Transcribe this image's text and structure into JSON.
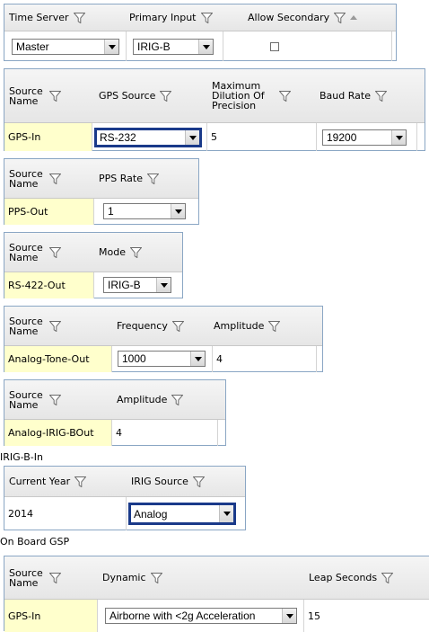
{
  "time_server_table": {
    "headers": [
      "Time Server",
      "Primary Input",
      "Allow Secondary"
    ],
    "time_server_value": "Master",
    "primary_input_value": "IRIG-B",
    "allow_secondary_checked": false
  },
  "gps_table": {
    "headers": {
      "source_name": "Source Name",
      "gps_source": "GPS Source",
      "mdop": "Maximum Dilution Of Precision",
      "baud_rate": "Baud Rate"
    },
    "row": {
      "name": "GPS-In",
      "gps_source": "RS-232",
      "mdop": "5",
      "baud_rate": "19200"
    }
  },
  "pps_table": {
    "headers": {
      "source_name": "Source Name",
      "pps_rate": "PPS Rate"
    },
    "row": {
      "name": "PPS-Out",
      "pps_rate": "1"
    }
  },
  "rs422_table": {
    "headers": {
      "source_name": "Source Name",
      "mode": "Mode"
    },
    "row": {
      "name": "RS-422-Out",
      "mode": "IRIG-B"
    }
  },
  "analog_tone_table": {
    "headers": {
      "source_name": "Source Name",
      "frequency": "Frequency",
      "amplitude": "Amplitude"
    },
    "row": {
      "name": "Analog-Tone-Out",
      "frequency": "1000",
      "amplitude": "4"
    }
  },
  "analog_irig_table": {
    "headers": {
      "source_name": "Source Name",
      "amplitude": "Amplitude"
    },
    "row": {
      "name": "Analog-IRIG-BOut",
      "amplitude": "4"
    }
  },
  "irig_b_in": {
    "caption": "IRIG-B-In",
    "headers": {
      "current_year": "Current Year",
      "irig_source": "IRIG Source"
    },
    "row": {
      "current_year": "2014",
      "irig_source": "Analog"
    }
  },
  "on_board_gsp": {
    "caption": "On Board GSP",
    "headers": {
      "source_name": "Source Name",
      "dynamic": "Dynamic",
      "leap_seconds": "Leap Seconds"
    },
    "row": {
      "name": "GPS-In",
      "dynamic": "Airborne with <2g Acceleration",
      "leap_seconds": "15"
    }
  },
  "icons": {
    "filter": "funnel-filter-icon",
    "sort": "sort-ascending-icon",
    "dropdown": "chevron-down-icon"
  },
  "colors": {
    "header_bg": "#e9e9e9",
    "name_cell_bg": "#ffffcc",
    "table_border": "#8aa6c4",
    "focus_border": "#1a3a8a"
  }
}
